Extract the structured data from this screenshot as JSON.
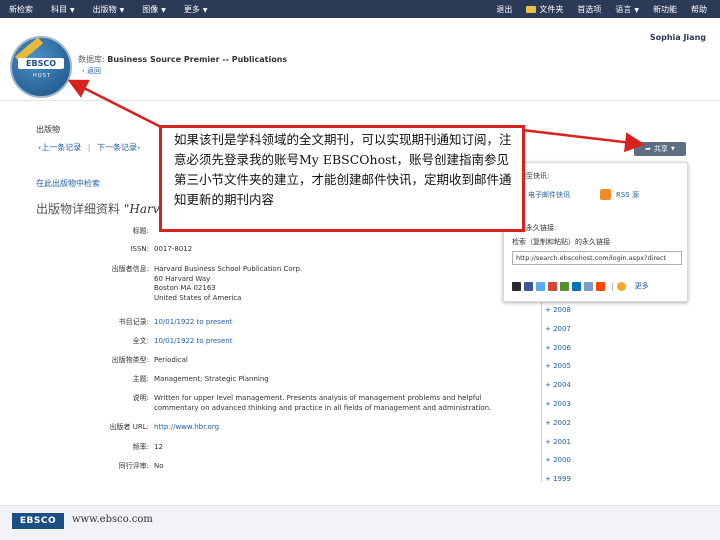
{
  "nav": {
    "new_search": "新检索",
    "subjects": "科目",
    "publications": "出版物",
    "images": "图像",
    "more": "更多",
    "sign_out": "退出",
    "folder": "文件夹",
    "preferences": "首选项",
    "language": "语言",
    "new_features": "新功能",
    "help": "帮助"
  },
  "user": {
    "name": "Sophia Jiang"
  },
  "logo": {
    "brand": "EBSCO",
    "host": "HOST"
  },
  "header": {
    "db_label": "数据库:",
    "db_name": "Business Source Premier -- Publications",
    "back": "‹ 返回"
  },
  "section": {
    "title": "出版物",
    "prev": "‹上一条记录",
    "separator": "|",
    "next": "下一条记录›",
    "all_pubs": "在此出版物中检索",
    "detail_prefix": "出版物详细资料",
    "pub_title": "\"Harvard Business Review\""
  },
  "details": {
    "title_label": "标题:",
    "issn_label": "ISSN:",
    "issn": "0017-8012",
    "pubinfo_label": "出版者信息:",
    "pub_lines": [
      "Harvard Business School Publication Corp.",
      "60 Harvard Way",
      "Boston MA 02163",
      "United States of America"
    ],
    "bib_label": "书目记录:",
    "bib": "10/01/1922 to present",
    "full_label": "全文:",
    "full": "10/01/1922 to present",
    "ptype_label": "出版物类型:",
    "ptype": "Periodical",
    "subj_label": "主题:",
    "subj": "Management; Strategic Planning",
    "desc_label": "说明:",
    "desc": "Written for upper level management. Presents analysis of management problems and helpful commentary on advanced thinking and practice in all fields of management and administration.",
    "url_label": "出版者 URL:",
    "url": "http://www.hbr.org",
    "freq_label": "频率:",
    "freq": "12",
    "peer_label": "同行评审:",
    "peer": "No"
  },
  "years": [
    "+ 2008",
    "+ 2007",
    "+ 2006",
    "+ 2005",
    "+ 2004",
    "+ 2003",
    "+ 2002",
    "+ 2001",
    "+ 2000",
    "+ 1999"
  ],
  "share": {
    "button": "共享",
    "email_label": "添加至快讯:",
    "email_alert": "电子邮件快讯",
    "rss": "RSS 源",
    "perma_label": "使用永久链接:",
    "bookmark_hint": "检索（复制和粘贴）的永久链接",
    "url": "http://search.ebscohost.com/login.aspx?direct",
    "more": "更多"
  },
  "annotation": {
    "text": "如果该刊是学科领域的全文期刊，可以实现期刊通知订阅，注意必须先登录我的账号My EBSCOhost，账号创建指南参见第三小节文件夹的建立，才能创建邮件快讯，定期收到邮件通知更新的期刊内容"
  },
  "footer": {
    "logo": "EBSCO",
    "url": "www.ebsco.com"
  },
  "colors": {
    "nav_bg": "#2b3a57",
    "link": "#1f5fa8",
    "annotation_border": "#d9211d"
  }
}
